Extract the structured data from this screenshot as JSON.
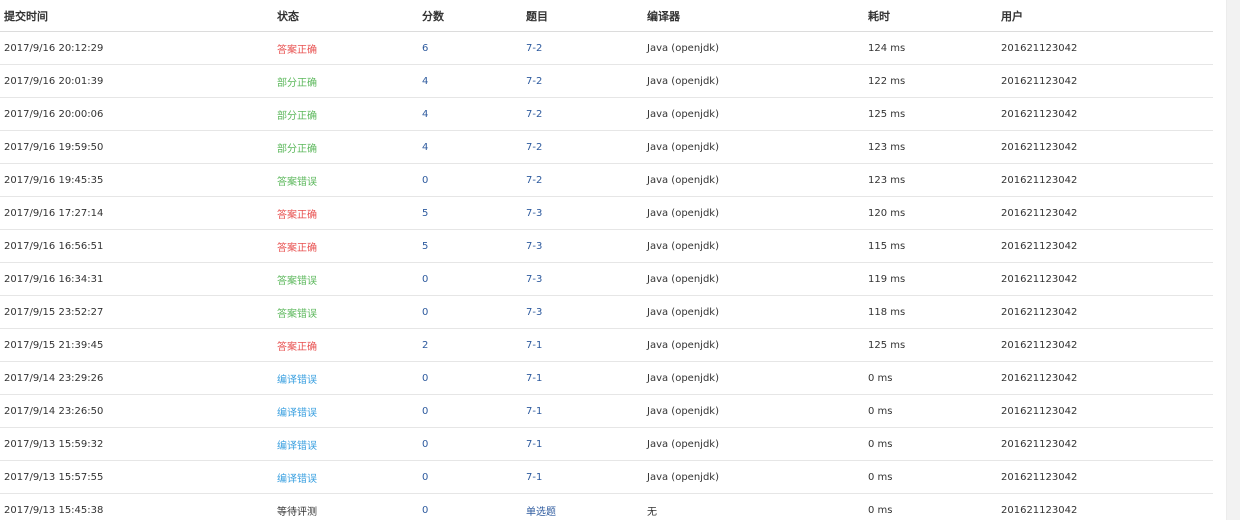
{
  "headers": {
    "time": "提交时间",
    "status": "状态",
    "score": "分数",
    "problem": "题目",
    "compiler": "编译器",
    "elapsed": "耗时",
    "user": "用户"
  },
  "colors": {
    "accepted": "#e8504f",
    "partial": "#5cb85c",
    "wrong": "#5cb85c",
    "compile_error": "#3aa0e0",
    "pending": "#333333",
    "link": "#2d5a9e"
  },
  "rows": [
    {
      "time": "2017/9/16 20:12:29",
      "status": "答案正确",
      "status_type": "accepted",
      "score": "6",
      "problem": "7-2",
      "compiler": "Java (openjdk)",
      "elapsed": "124 ms",
      "user": "201621123042"
    },
    {
      "time": "2017/9/16 20:01:39",
      "status": "部分正确",
      "status_type": "partial",
      "score": "4",
      "problem": "7-2",
      "compiler": "Java (openjdk)",
      "elapsed": "122 ms",
      "user": "201621123042"
    },
    {
      "time": "2017/9/16 20:00:06",
      "status": "部分正确",
      "status_type": "partial",
      "score": "4",
      "problem": "7-2",
      "compiler": "Java (openjdk)",
      "elapsed": "125 ms",
      "user": "201621123042"
    },
    {
      "time": "2017/9/16 19:59:50",
      "status": "部分正确",
      "status_type": "partial",
      "score": "4",
      "problem": "7-2",
      "compiler": "Java (openjdk)",
      "elapsed": "123 ms",
      "user": "201621123042"
    },
    {
      "time": "2017/9/16 19:45:35",
      "status": "答案错误",
      "status_type": "wrong",
      "score": "0",
      "problem": "7-2",
      "compiler": "Java (openjdk)",
      "elapsed": "123 ms",
      "user": "201621123042"
    },
    {
      "time": "2017/9/16 17:27:14",
      "status": "答案正确",
      "status_type": "accepted",
      "score": "5",
      "problem": "7-3",
      "compiler": "Java (openjdk)",
      "elapsed": "120 ms",
      "user": "201621123042"
    },
    {
      "time": "2017/9/16 16:56:51",
      "status": "答案正确",
      "status_type": "accepted",
      "score": "5",
      "problem": "7-3",
      "compiler": "Java (openjdk)",
      "elapsed": "115 ms",
      "user": "201621123042"
    },
    {
      "time": "2017/9/16 16:34:31",
      "status": "答案错误",
      "status_type": "wrong",
      "score": "0",
      "problem": "7-3",
      "compiler": "Java (openjdk)",
      "elapsed": "119 ms",
      "user": "201621123042"
    },
    {
      "time": "2017/9/15 23:52:27",
      "status": "答案错误",
      "status_type": "wrong",
      "score": "0",
      "problem": "7-3",
      "compiler": "Java (openjdk)",
      "elapsed": "118 ms",
      "user": "201621123042"
    },
    {
      "time": "2017/9/15 21:39:45",
      "status": "答案正确",
      "status_type": "accepted",
      "score": "2",
      "problem": "7-1",
      "compiler": "Java (openjdk)",
      "elapsed": "125 ms",
      "user": "201621123042"
    },
    {
      "time": "2017/9/14 23:29:26",
      "status": "编译错误",
      "status_type": "compile_error",
      "score": "0",
      "problem": "7-1",
      "compiler": "Java (openjdk)",
      "elapsed": "0 ms",
      "user": "201621123042"
    },
    {
      "time": "2017/9/14 23:26:50",
      "status": "编译错误",
      "status_type": "compile_error",
      "score": "0",
      "problem": "7-1",
      "compiler": "Java (openjdk)",
      "elapsed": "0 ms",
      "user": "201621123042"
    },
    {
      "time": "2017/9/13 15:59:32",
      "status": "编译错误",
      "status_type": "compile_error",
      "score": "0",
      "problem": "7-1",
      "compiler": "Java (openjdk)",
      "elapsed": "0 ms",
      "user": "201621123042"
    },
    {
      "time": "2017/9/13 15:57:55",
      "status": "编译错误",
      "status_type": "compile_error",
      "score": "0",
      "problem": "7-1",
      "compiler": "Java (openjdk)",
      "elapsed": "0 ms",
      "user": "201621123042"
    },
    {
      "time": "2017/9/13 15:45:38",
      "status": "等待评测",
      "status_type": "pending",
      "score": "0",
      "problem": "单选题",
      "compiler": "无",
      "elapsed": "0 ms",
      "user": "201621123042"
    }
  ]
}
